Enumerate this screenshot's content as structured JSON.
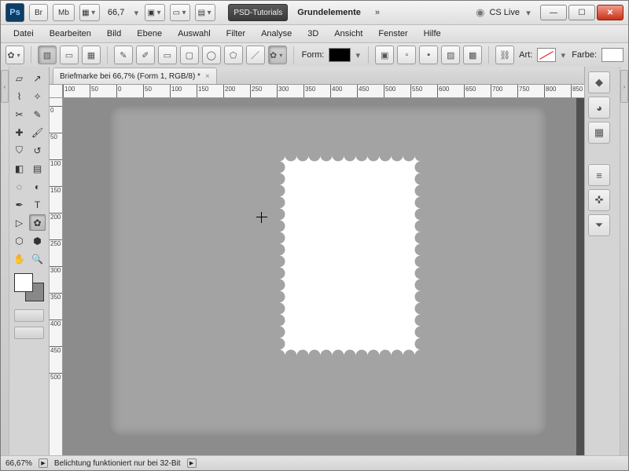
{
  "title": {
    "app_short": "Ps",
    "bridge": "Br",
    "minibridge": "Mb",
    "zoom": "66,7",
    "workspace_active": "PSD-Tutorials",
    "workspace_other": "Grundelemente",
    "cs_live": "CS Live"
  },
  "menu": [
    "Datei",
    "Bearbeiten",
    "Bild",
    "Ebene",
    "Auswahl",
    "Filter",
    "Analyse",
    "3D",
    "Ansicht",
    "Fenster",
    "Hilfe"
  ],
  "options": {
    "form_label": "Form:",
    "art_label": "Art:",
    "farbe_label": "Farbe:"
  },
  "document": {
    "tab_title": "Briefmarke bei 66,7% (Form 1, RGB/8) *"
  },
  "ruler": {
    "h_labels": [
      "100",
      "50",
      "0",
      "50",
      "100",
      "150",
      "200",
      "250",
      "300",
      "350",
      "400",
      "450",
      "500",
      "550",
      "600",
      "650",
      "700",
      "750",
      "800",
      "850"
    ],
    "v_labels": [
      "0",
      "50",
      "100",
      "150",
      "200",
      "250",
      "300",
      "350",
      "400",
      "450",
      "500"
    ]
  },
  "status": {
    "zoom": "66,67%",
    "msg": "Belichtung funktioniert nur bei 32-Bit"
  },
  "colors": {
    "fg": "#ffffff",
    "bg": "#888888",
    "accent_dark": "#3a3a3a"
  }
}
